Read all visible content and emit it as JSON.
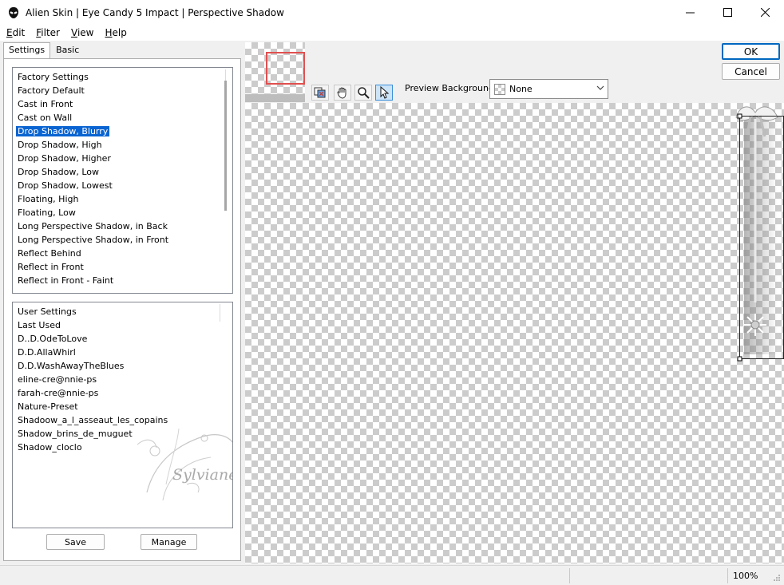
{
  "window": {
    "title": "Alien Skin | Eye Candy 5 Impact | Perspective Shadow",
    "controls": {
      "minimize": "—",
      "maximize": "☐",
      "close": "✕"
    }
  },
  "menu": [
    {
      "label": "Edit",
      "mnemonic": "E",
      "rest": "dit"
    },
    {
      "label": "Filter",
      "mnemonic": "F",
      "rest": "ilter"
    },
    {
      "label": "View",
      "mnemonic": "V",
      "rest": "iew"
    },
    {
      "label": "Help",
      "mnemonic": "H",
      "rest": "elp"
    }
  ],
  "tabs": {
    "settings": "Settings",
    "basic": "Basic"
  },
  "factory_settings": {
    "header": "Factory Settings",
    "selected_index": 3,
    "items": [
      "Factory Default",
      "Cast in Front",
      "Cast on Wall",
      "Drop Shadow, Blurry",
      "Drop Shadow, High",
      "Drop Shadow, Higher",
      "Drop Shadow, Low",
      "Drop Shadow, Lowest",
      "Floating, High",
      "Floating, Low",
      "Long Perspective Shadow, in Back",
      "Long Perspective Shadow, in Front",
      "Reflect Behind",
      "Reflect in Front",
      "Reflect in Front - Faint"
    ]
  },
  "user_settings": {
    "header": "User Settings",
    "items": [
      "Last Used",
      "D..D.OdeToLove",
      "D.D.AllaWhirl",
      "D.D.WashAwayTheBlues",
      "eline-cre@nnie-ps",
      "farah-cre@nnie-ps",
      "Nature-Preset",
      "Shadoow_a_l_asseaut_les_copains",
      "Shadow_brins_de_muguet",
      "Shadow_cloclo"
    ]
  },
  "buttons": {
    "save": "Save",
    "manage": "Manage",
    "ok": "OK",
    "cancel": "Cancel"
  },
  "preview": {
    "background_label": "Preview Background:",
    "background_value": "None"
  },
  "watermark": {
    "text": "Sylviane"
  },
  "status": {
    "zoom": "100%"
  },
  "colors": {
    "selection": "#0a64d2",
    "nav_rect": "#e05050",
    "ok_border": "#0067c0"
  }
}
